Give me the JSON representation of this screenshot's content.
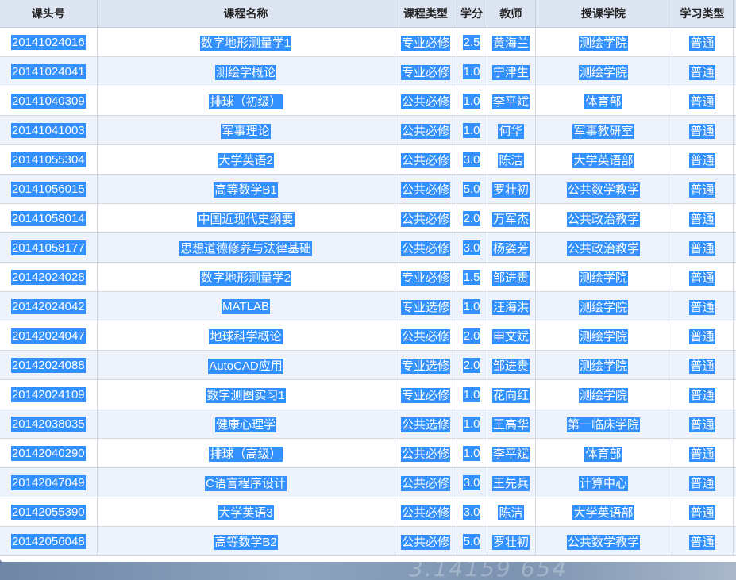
{
  "table": {
    "headers": [
      "课头号",
      "课程名称",
      "课程类型",
      "学分",
      "教师",
      "授课学院",
      "学习类型"
    ],
    "rows": [
      [
        "20141024016",
        "数字地形测量学1",
        "专业必修",
        "2.5",
        "黄海兰",
        "测绘学院",
        "普通"
      ],
      [
        "20141024041",
        "测绘学概论",
        "专业必修",
        "1.0",
        "宁津生",
        "测绘学院",
        "普通"
      ],
      [
        "20141040309",
        "排球（初级）",
        "公共必修",
        "1.0",
        "李平斌",
        "体育部",
        "普通"
      ],
      [
        "20141041003",
        "军事理论",
        "公共必修",
        "1.0",
        "何华",
        "军事教研室",
        "普通"
      ],
      [
        "20141055304",
        "大学英语2",
        "公共必修",
        "3.0",
        "陈洁",
        "大学英语部",
        "普通"
      ],
      [
        "20141056015",
        "高等数学B1",
        "公共必修",
        "5.0",
        "罗壮初",
        "公共数学教学",
        "普通"
      ],
      [
        "20141058014",
        "中国近现代史纲要",
        "公共必修",
        "2.0",
        "万军杰",
        "公共政治教学",
        "普通"
      ],
      [
        "20141058177",
        "思想道德修养与法律基础",
        "公共必修",
        "3.0",
        "杨姿芳",
        "公共政治教学",
        "普通"
      ],
      [
        "20142024028",
        "数字地形测量学2",
        "专业必修",
        "1.5",
        "邹进贵",
        "测绘学院",
        "普通"
      ],
      [
        "20142024042",
        "MATLAB",
        "专业选修",
        "1.0",
        "汪海洪",
        "测绘学院",
        "普通"
      ],
      [
        "20142024047",
        "地球科学概论",
        "公共必修",
        "2.0",
        "申文斌",
        "测绘学院",
        "普通"
      ],
      [
        "20142024088",
        "AutoCAD应用",
        "专业选修",
        "2.0",
        "邹进贵",
        "测绘学院",
        "普通"
      ],
      [
        "20142024109",
        "数字测图实习1",
        "专业必修",
        "1.0",
        "花向红",
        "测绘学院",
        "普通"
      ],
      [
        "20142038035",
        "健康心理学",
        "公共选修",
        "1.0",
        "王高华",
        "第一临床学院",
        "普通"
      ],
      [
        "20142040290",
        "排球（高级）",
        "公共必修",
        "1.0",
        "李平斌",
        "体育部",
        "普通"
      ],
      [
        "20142047049",
        "C语言程序设计",
        "公共必修",
        "3.0",
        "王先兵",
        "计算中心",
        "普通"
      ],
      [
        "20142055390",
        "大学英语3",
        "公共必修",
        "3.0",
        "陈洁",
        "大学英语部",
        "普通"
      ],
      [
        "20142056048",
        "高等数学B2",
        "公共必修",
        "5.0",
        "罗壮初",
        "公共数学教学",
        "普通"
      ]
    ]
  },
  "background_text": "3.14159 654",
  "colors": {
    "header_bg": "#dde4f2",
    "row_alt_bg": "#eef2fb",
    "selection": "#3390ff"
  }
}
